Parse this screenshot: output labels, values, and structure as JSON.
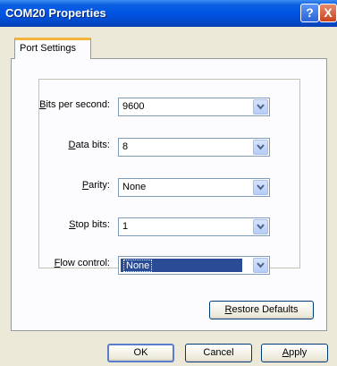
{
  "window": {
    "title": "COM20 Properties",
    "help_label": "?",
    "close_label": "X"
  },
  "tabs": [
    {
      "label": "Port Settings"
    }
  ],
  "fields": [
    {
      "label_u": "B",
      "label_rest": "its per second:",
      "value": "9600"
    },
    {
      "label_u": "D",
      "label_rest": "ata bits:",
      "value": "8"
    },
    {
      "label_pre": "",
      "label_u": "P",
      "label_rest": "arity:",
      "value": "None"
    },
    {
      "label_u": "S",
      "label_rest": "top bits:",
      "value": "1"
    },
    {
      "label_u": "F",
      "label_rest": "low control:",
      "value": "None"
    }
  ],
  "buttons": {
    "restore_u": "R",
    "restore_rest": "estore Defaults",
    "ok": "OK",
    "cancel": "Cancel",
    "apply_u": "A",
    "apply_rest": "pply"
  }
}
